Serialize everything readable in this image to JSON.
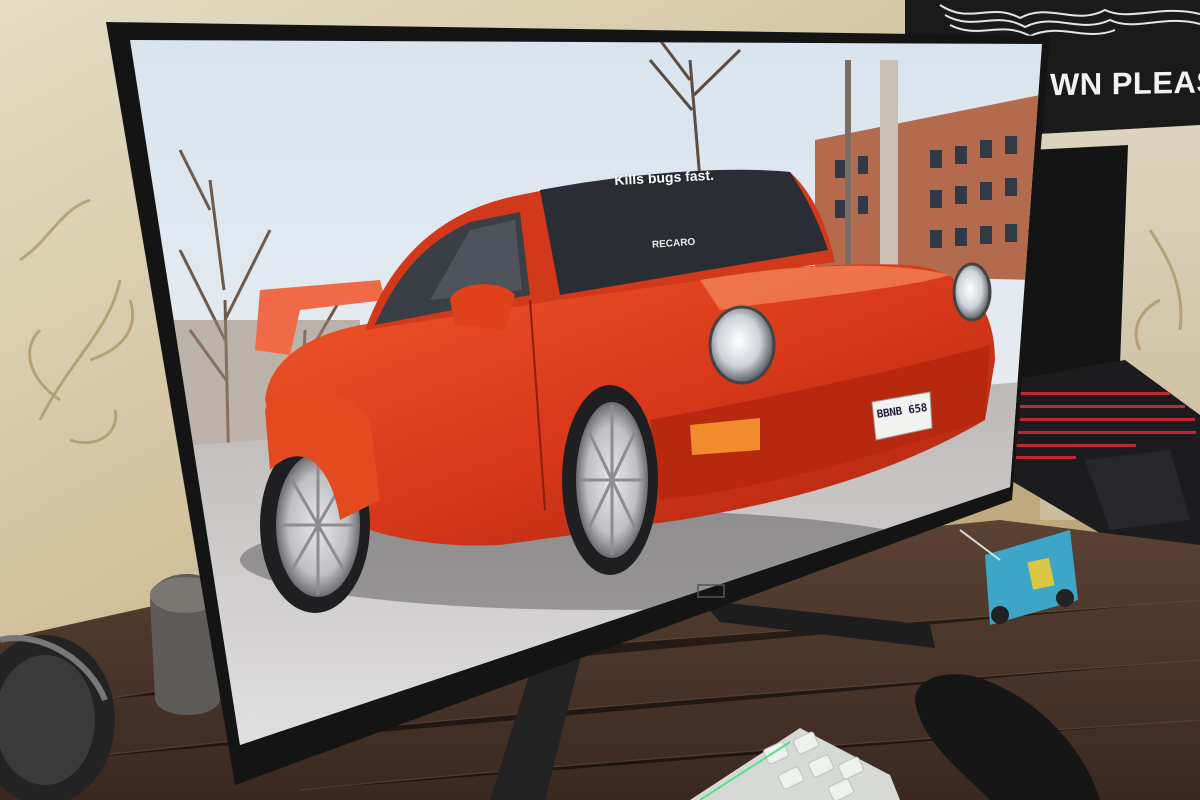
{
  "photo": {
    "poster_text": "WN PLEASURE",
    "windshield_banner": "Kills bugs fast.",
    "seat_brand": "RECARO",
    "license_plate": "BBNB 658"
  },
  "colors": {
    "wall": "#d9cdb2",
    "desk": "#4a3328",
    "monitor_bezel": "#141414",
    "car_red": "#e0401a",
    "sky": "#dfe7ee",
    "poster": "#1a1a1a",
    "laptop_key_glow": "#e0283a"
  }
}
